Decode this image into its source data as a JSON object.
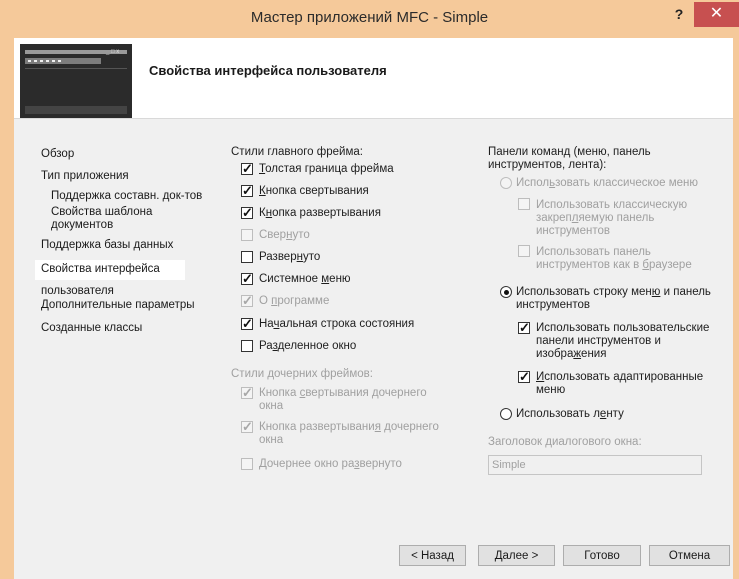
{
  "window": {
    "title": "Мастер приложений MFC - Simple",
    "help": "?",
    "close": "✕"
  },
  "header": {
    "page_title": "Свойства интерфейса пользователя"
  },
  "nav": {
    "items": [
      {
        "label": "Обзор"
      },
      {
        "label": "Тип приложения"
      },
      {
        "label": "Поддержка составн. док-тов"
      },
      {
        "label": "Свойства шаблона"
      },
      {
        "label": "документов"
      },
      {
        "label": "Поддержка базы данных"
      },
      {
        "label": "Свойства интерфейса"
      },
      {
        "label": "пользователя"
      },
      {
        "label": "Дополнительные параметры"
      },
      {
        "label": "Созданные классы"
      }
    ]
  },
  "main_frame": {
    "heading": "Стили главного фрейма:",
    "options": [
      {
        "pre": "",
        "acc": "Т",
        "post": "олстая граница фрейма",
        "checked": true,
        "disabled": false
      },
      {
        "pre": "",
        "acc": "К",
        "post": "нопка свертывания",
        "checked": true,
        "disabled": false
      },
      {
        "pre": "К",
        "acc": "н",
        "post": "опка развертывания",
        "checked": true,
        "disabled": false
      },
      {
        "pre": "Свер",
        "acc": "н",
        "post": "уто",
        "checked": false,
        "disabled": true
      },
      {
        "pre": "Развер",
        "acc": "н",
        "post": "уто",
        "checked": false,
        "disabled": false
      },
      {
        "pre": "Системное ",
        "acc": "м",
        "post": "еню",
        "checked": true,
        "disabled": false
      },
      {
        "pre": "О ",
        "acc": "п",
        "post": "рограмме",
        "checked": true,
        "disabled": true
      },
      {
        "pre": "На",
        "acc": "ч",
        "post": "альная строка состояния",
        "checked": true,
        "disabled": false
      },
      {
        "pre": "Ра",
        "acc": "з",
        "post": "деленное окно",
        "checked": false,
        "disabled": false
      }
    ]
  },
  "child_frame": {
    "heading": "Стили дочерних фреймов:",
    "opt1_pre": "Кнопка ",
    "opt1_acc": "с",
    "opt1_post": "вертывания дочернего",
    "opt1_line2": "окна",
    "opt2_pre": "Кнопка развертывани",
    "opt2_acc": "я",
    "opt2_post": " дочернего",
    "opt2_line2": "окна",
    "opt3_pre": "Дочернее окно ра",
    "opt3_acc": "з",
    "opt3_post": "вернуто"
  },
  "command_bars": {
    "heading_line1": "Панели команд (меню, панель",
    "heading_line2": "инструментов, лента):",
    "classic_pre": "Испол",
    "classic_acc": "ь",
    "classic_post": "зовать классическое меню",
    "classic_sub1_line1": "Использовать классическую",
    "classic_sub1_line2_pre": "закреп",
    "classic_sub1_line2_acc": "л",
    "classic_sub1_line2_post": "яемую панель",
    "classic_sub1_line3": "инструментов",
    "classic_sub2_line1": "Использовать панель",
    "classic_sub2_line2_pre": "инструментов как в ",
    "classic_sub2_line2_acc": "б",
    "classic_sub2_line2_post": "раузере",
    "menubar_line1_pre": "Использовать строку мен",
    "menubar_line1_acc": "ю",
    "menubar_line1_post": " и панель",
    "menubar_line2": "инструментов",
    "menubar_sub1_line1": "Использовать пользовательские",
    "menubar_sub1_line2": "панели инструментов и",
    "menubar_sub1_line3_pre": "изобра",
    "menubar_sub1_line3_acc": "ж",
    "menubar_sub1_line3_post": "ения",
    "menubar_sub2_line1_pre": "",
    "menubar_sub2_line1_acc": "И",
    "menubar_sub2_line1_post": "спользовать адаптированные",
    "menubar_sub2_line2": "меню",
    "ribbon_pre": "Использовать л",
    "ribbon_acc": "е",
    "ribbon_post": "нту",
    "dialog_title_label": "Заголовок диалогового окна:",
    "dialog_title_value": "Simple"
  },
  "buttons": {
    "back": "< Назад",
    "next": "Далее >",
    "finish": "Готово",
    "cancel": "Отмена"
  }
}
